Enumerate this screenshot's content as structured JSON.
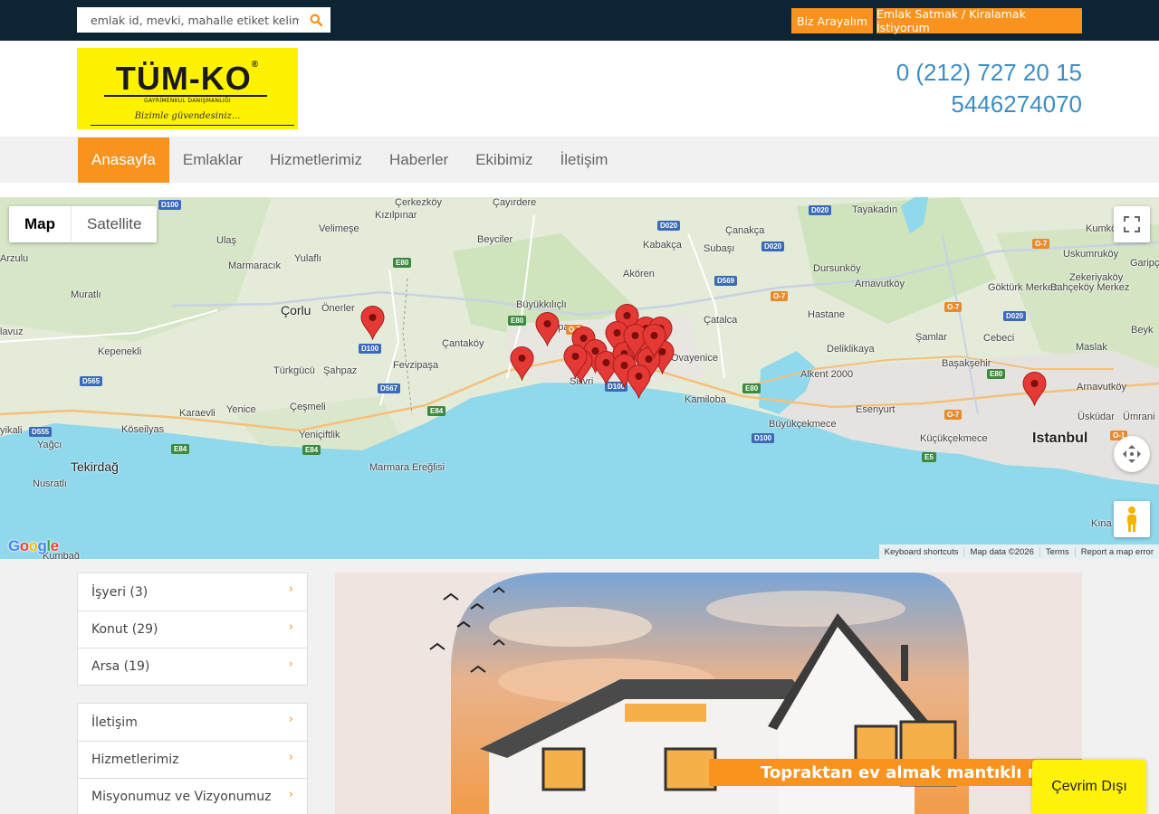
{
  "topbar": {
    "search_placeholder": "emlak id, mevki, mahalle etiket kelimesi gibi",
    "call_button": "Biz Arayalım",
    "sell_button": "Emlak Satmak / Kiralamak İstiyorum"
  },
  "header": {
    "logo": {
      "brand": "TÜM-KO",
      "registered": "®",
      "subtitle": "GAYRİMENKUL DANIŞMANLIĞI",
      "slogan": "Bizimle güvendesiniz..."
    },
    "phone1": "0 (212) 727 20 15",
    "phone2": "5446274070"
  },
  "nav": {
    "items": [
      "Anasayfa",
      "Emlaklar",
      "Hizmetlerimiz",
      "Haberler",
      "Ekibimiz",
      "İletişim"
    ],
    "active": "Anasayfa"
  },
  "map": {
    "type_map": "Map",
    "type_satellite": "Satellite",
    "google": "Google",
    "keyboard_shortcuts": "Keyboard shortcuts",
    "map_data": "Map data ©2026",
    "terms": "Terms",
    "report": "Report a map error",
    "places": [
      "Çerkezköy",
      "Çayırdere",
      "Kızılpınar",
      "Velimeşe",
      "Ulaş",
      "Beyciler",
      "Kabakça",
      "Subaşı",
      "Çanakça",
      "Tayakadın",
      "Kumkö",
      "Uskumruköy",
      "Arzulu",
      "Yulaflı",
      "Marmaracık",
      "Akören",
      "Dursunköy",
      "Garipç",
      "Zekeriyaköy",
      "Muratlı",
      "Büyükkılıçlı",
      "Arnavutköy",
      "Göktürk Merkez",
      "Bahçeköy Merkez",
      "Çorlu",
      "Önerler",
      "Hastane",
      "Çatalca",
      "Cebeci",
      "Şamlar",
      "Beyk",
      "lavuz",
      "Kepenekli",
      "Çantaköy",
      "Deliklikaya",
      "Maslak",
      "Başakşehir",
      "Alipaşa",
      "Ovayenice",
      "Türkgücü",
      "Şahpaz",
      "Fevzipaşa",
      "Alkent 2000",
      "Arnavutköy",
      "Silivri",
      "Kamiloba",
      "Esenyurt",
      "Üsküdar",
      "Ümrani",
      "Karaevli",
      "Yenice",
      "Çeşmeli",
      "Büyükçekmece",
      "Köseilyas",
      "yikali",
      "Yeniçiftlik",
      "Küçükçekmece",
      "Istanbul",
      "Yağcı",
      "Tekirdağ",
      "Marmara Ereğlisi",
      "Nusratlı",
      "Kına",
      "Kumbağ"
    ],
    "roads": [
      "D100",
      "D020",
      "D020",
      "D020",
      "O-7",
      "E80",
      "E80",
      "D569",
      "O-7",
      "O-7",
      "D020",
      "D100",
      "D565",
      "D567",
      "E84",
      "E80",
      "E80",
      "O-7",
      "D100",
      "D555",
      "E84",
      "E84",
      "D100",
      "E5",
      "O-1",
      "D100",
      "O-7"
    ]
  },
  "sidebar": {
    "categories": [
      "İşyeri (3)",
      "Konut (29)",
      "Arsa (19)"
    ],
    "pages": [
      "İletişim",
      "Hizmetlerimiz",
      "Misyonumuz ve Vizyonumuz"
    ],
    "chevron": "›"
  },
  "banner": {
    "caption": "Topraktan ev almak mantıklı mı?"
  },
  "chat": {
    "status": "Çevrim Dışı"
  },
  "colors": {
    "accent": "#f7931e",
    "topbar": "#0c2433",
    "phone": "#3d8ec4",
    "logo_bg": "#fff200",
    "sea": "#90d8ec",
    "pin": "#e53935"
  }
}
